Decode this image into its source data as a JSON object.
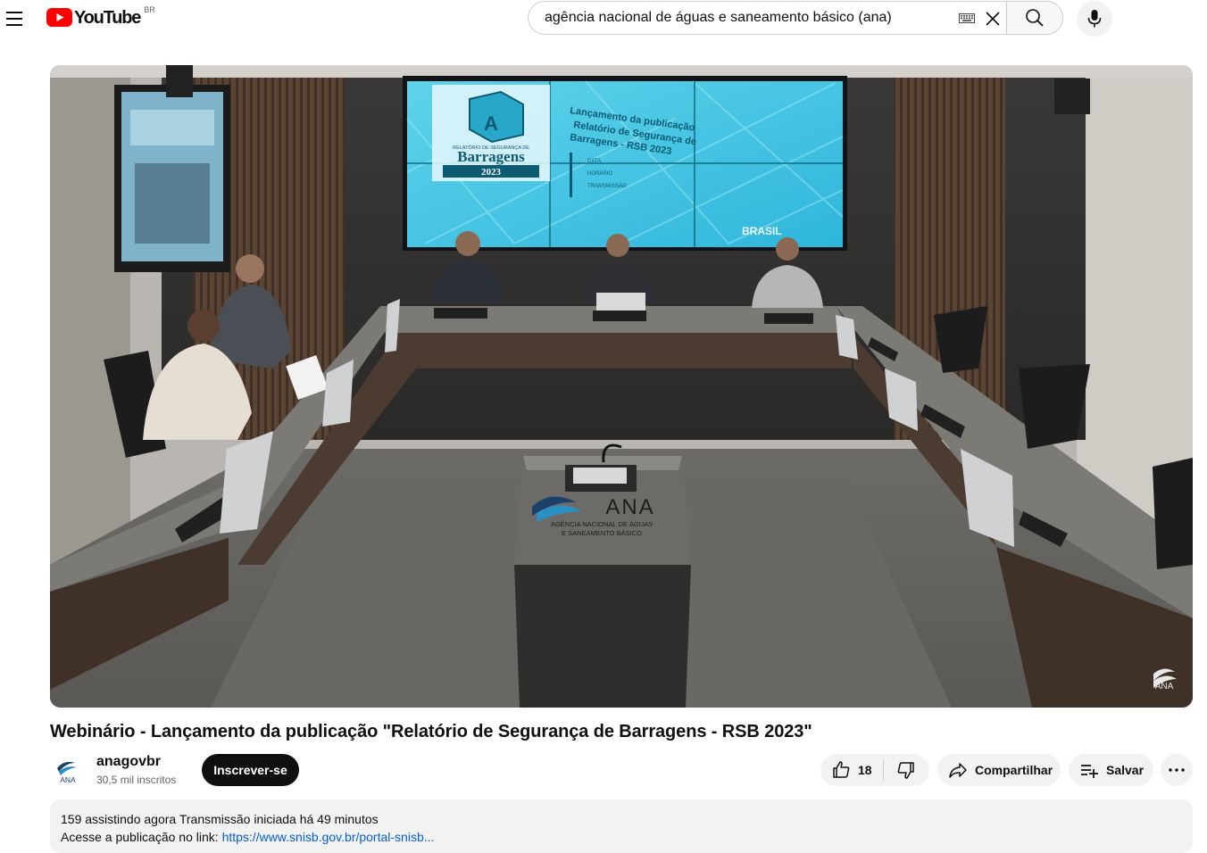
{
  "header": {
    "logo_text": "YouTube",
    "region": "BR",
    "search_value": "agência nacional de águas e saneamento básico (ana)"
  },
  "player": {
    "slide_title": "Barragens",
    "slide_year": "2023",
    "slide_small": "RELATÓRIO DE SEGURANÇA DE",
    "slide_heading": "Lançamento da publicação Relatório de Segurança de Barragens RSB 2023",
    "slide_items": [
      "DATA",
      "HORÁRIO",
      "TRANSMISSÃO"
    ],
    "slide_brand": "BRASIL",
    "podium_logo": "ANA",
    "podium_line1": "AGÊNCIA NACIONAL DE ÁGUAS",
    "podium_line2": "E SANEAMENTO BÁSICO",
    "watermark": "ANA"
  },
  "video": {
    "title": "Webinário - Lançamento da publicação \"Relatório de Segurança de Barragens - RSB 2023\""
  },
  "channel": {
    "avatar_text": "ANA",
    "name": "anagovbr",
    "subscribers": "30,5 mil inscritos",
    "subscribe_label": "Inscrever-se"
  },
  "actions": {
    "likes": "18",
    "share_label": "Compartilhar",
    "save_label": "Salvar"
  },
  "description": {
    "stats": "159 assistindo agora  Transmissão iniciada há 49 minutos",
    "line_prefix": "Acesse a publicação no link: ",
    "link": "https://www.snisb.gov.br/portal-snisb..."
  },
  "colors": {
    "brand_red": "#ff0000",
    "link_blue": "#065fd4",
    "pill_bg": "#f2f2f2",
    "subscribe_bg": "#0f0f0f"
  }
}
